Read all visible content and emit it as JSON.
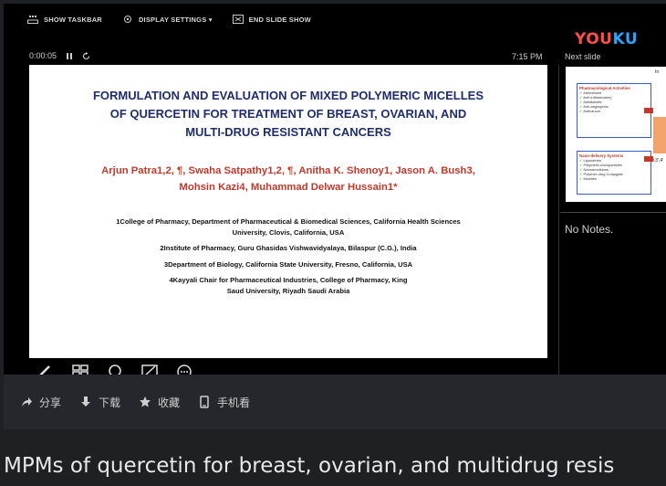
{
  "toolbar": {
    "show_taskbar": "SHOW TASKBAR",
    "display_settings": "DISPLAY SETTINGS ▾",
    "end_slide_show": "END SLIDE SHOW"
  },
  "logo": {
    "part1": "YOU",
    "part2": "KU",
    "color1": "#ff4d4d",
    "color2": "#29a3ff"
  },
  "presenter": {
    "timer": "0:00:05",
    "pause_icon": "pause-icon",
    "reset_icon": "reset-icon",
    "clock": "7:15 PM",
    "next_slide_label": "Next slide",
    "notes": "No Notes."
  },
  "slide": {
    "title_lines": [
      "FORMULATION AND EVALUATION OF MIXED POLYMERIC MICELLES",
      "OF QUERCETIN FOR TREATMENT OF BREAST, OVARIAN, AND",
      "MULTI-DRUG RESISTANT CANCERS"
    ],
    "author_lines": [
      "Arjun Patra1,2, ¶, Swaha Satpathy1,2, ¶, Anitha K. Shenoy1, Jason A. Bush3,",
      "Mohsin Kazi4, Muhammad Delwar Hussain1*"
    ],
    "affiliations": [
      "1College of Pharmacy, Department of Pharmaceutical & Biomedical Sciences, California Health Sciences University, Clovis, California, USA",
      "2Institute of Pharmacy, Guru Ghasidas Vishwavidyalaya, Bilaspur (C.G.), India",
      "3Department of Biology, California State University, Fresno, California, USA",
      "4Kayyali Chair for Pharmaceutical Industries, College of Pharmacy, King Saud University, Riyadh Saudi Arabia"
    ],
    "title_color": "#1f2e6b",
    "author_color": "#c0392b"
  },
  "next_slide": {
    "box1_title": "Pharmacological Activities",
    "box1_items": [
      "Antioxidant",
      "Anti-inflammatory",
      "Antidiabetic",
      "Anti-angiogenic",
      "Anticancer"
    ],
    "box2_title": "Nano-delivery Systems",
    "box2_items": [
      "Liposomes",
      "Polymeric nanoparticles",
      "Nanoemulsions",
      "Polymer-drug Conjugate",
      "Micelles"
    ],
    "fragment_top": "In",
    "fragment_mid": "O,3',4'"
  },
  "tools": [
    "pen-icon",
    "slides-grid-icon",
    "magnifier-icon",
    "pointer-icon",
    "more-icon"
  ],
  "actions": [
    {
      "icon": "share-icon",
      "label": "分享"
    },
    {
      "icon": "download-icon",
      "label": "下载"
    },
    {
      "icon": "star-icon",
      "label": "收藏"
    },
    {
      "icon": "phone-icon",
      "label": "手机看"
    }
  ],
  "caption": "MPMs of quercetin for breast, ovarian, and multidrug resis"
}
